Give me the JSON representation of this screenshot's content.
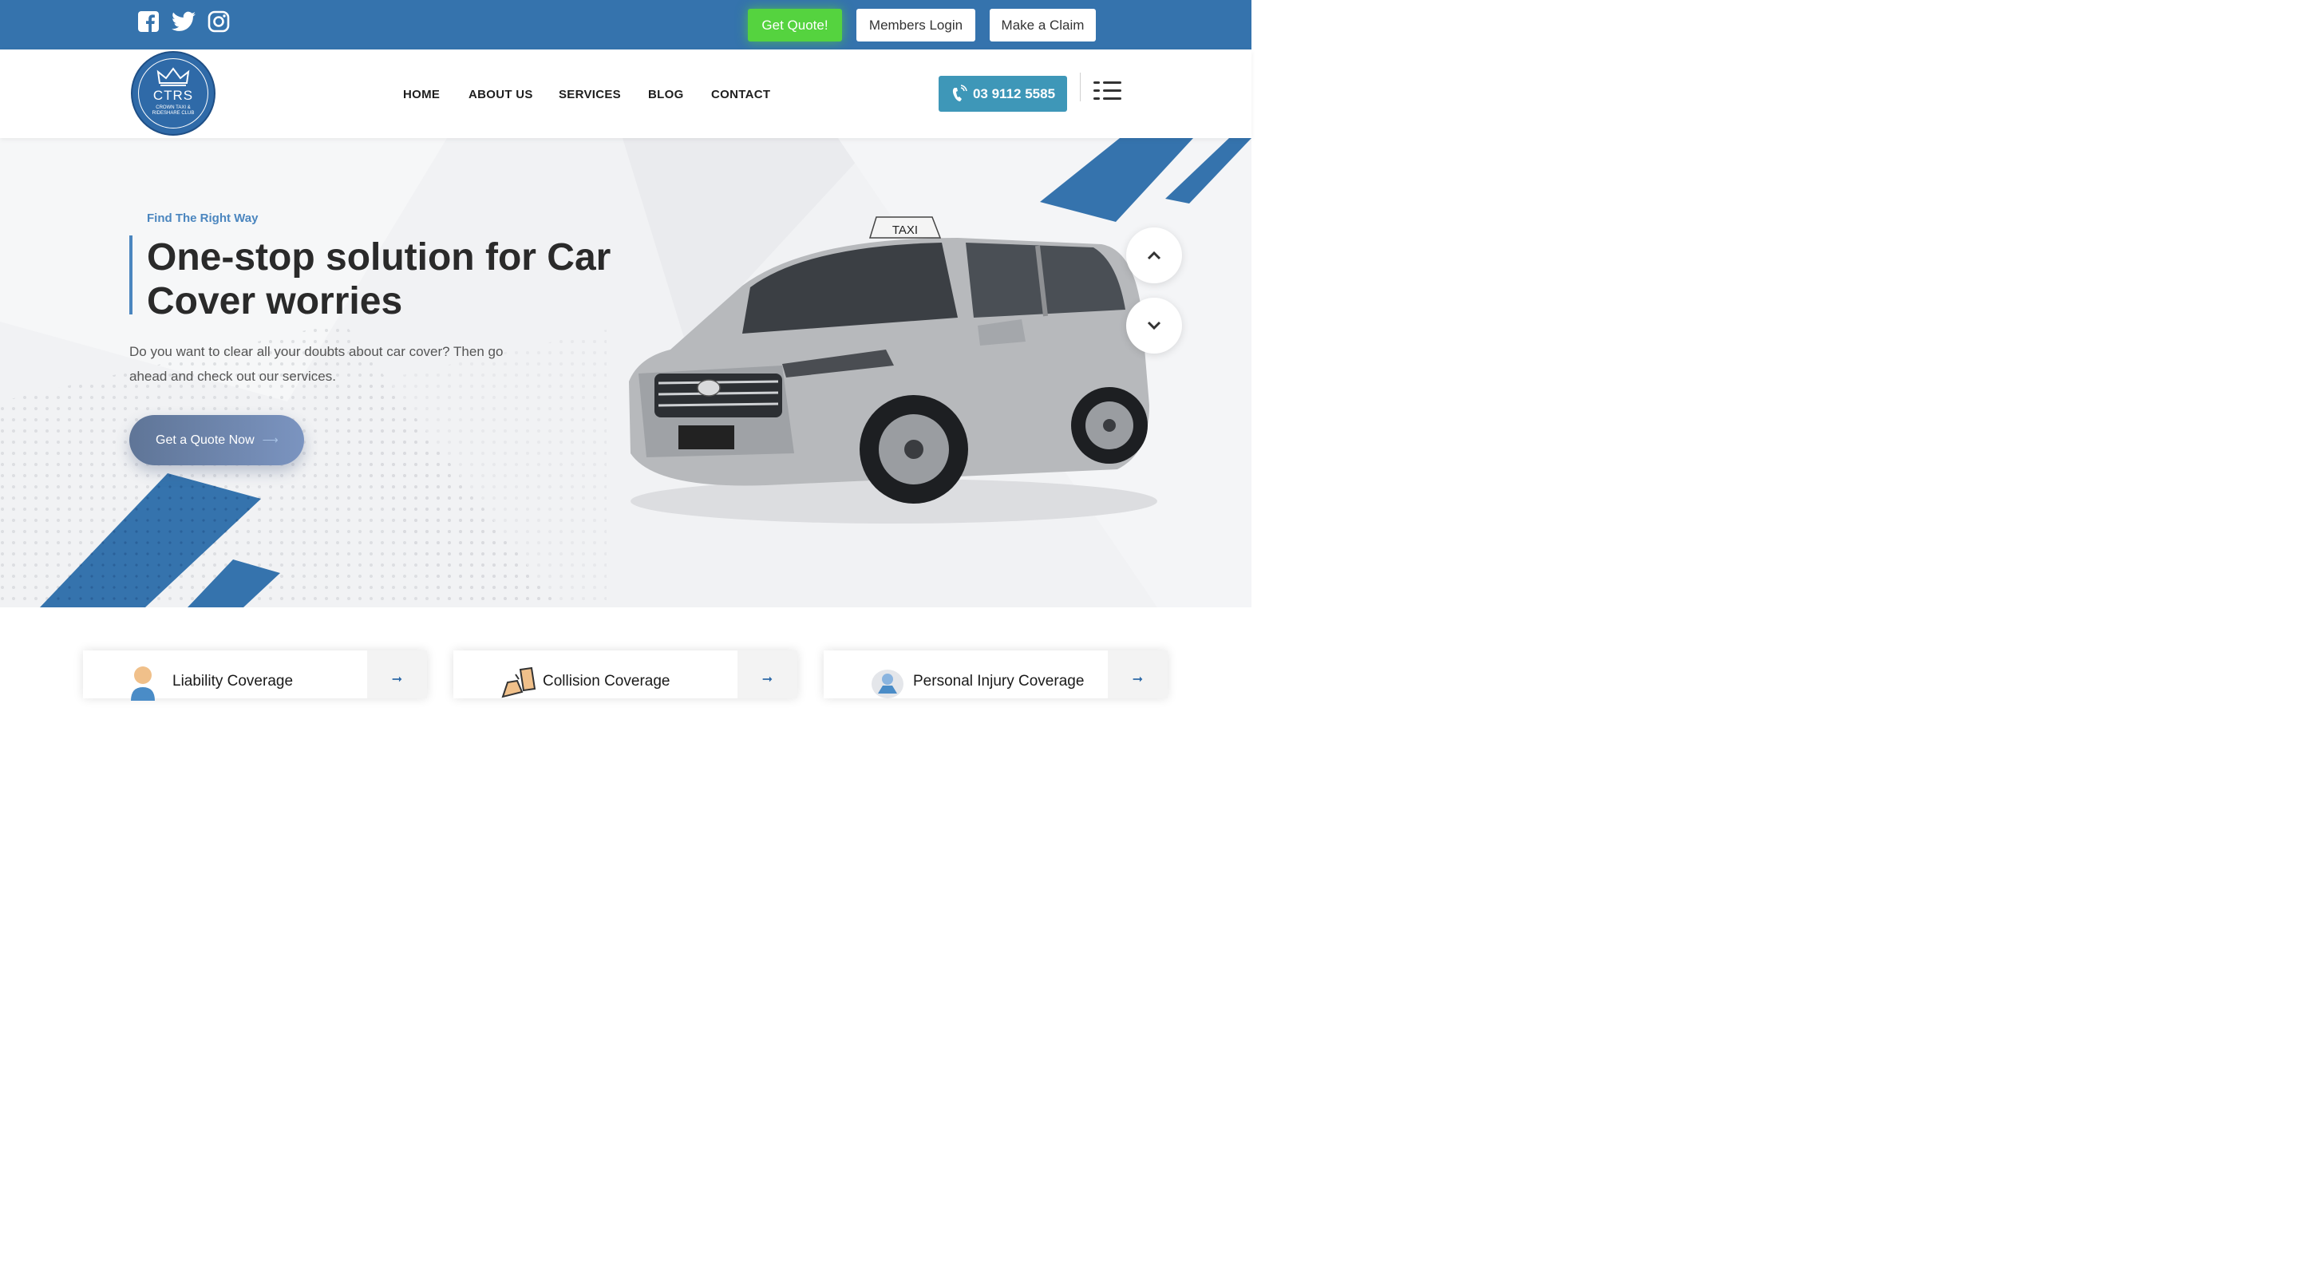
{
  "topbar": {
    "social_icons": [
      "facebook-icon",
      "twitter-icon",
      "instagram-icon"
    ],
    "get_quote": "Get Quote!",
    "members_login": "Members Login",
    "make_claim": "Make a Claim"
  },
  "header": {
    "logo": {
      "abbrev": "CTRS",
      "line1": "CROWN TAXI &",
      "line2": "RIDESHARE CLUB"
    },
    "nav": [
      "HOME",
      "ABOUT US",
      "SERVICES",
      "BLOG",
      "CONTACT"
    ],
    "phone": "03 9112 5585",
    "menu_icon": "hamburger-icon"
  },
  "hero": {
    "eyebrow": "Find The Right Way",
    "headline_line1": "One-stop solution for Car",
    "headline_line2": "Cover worries",
    "description_line1": "Do you want to clear all your doubts about car cover? Then go",
    "description_line2": "ahead and check out our services.",
    "cta": "Get a Quote Now",
    "taxi_sign": "TAXI"
  },
  "cards": [
    {
      "title": "Liability Coverage",
      "icon": "person-icon"
    },
    {
      "title": "Collision Coverage",
      "icon": "collision-icon"
    },
    {
      "title": "Personal Injury Coverage",
      "icon": "injury-icon"
    }
  ],
  "colors": {
    "brand_blue": "#3573ad",
    "quote_green": "#55d33f",
    "phone_teal": "#3e97b8",
    "accent_blue": "#4b86bf"
  }
}
